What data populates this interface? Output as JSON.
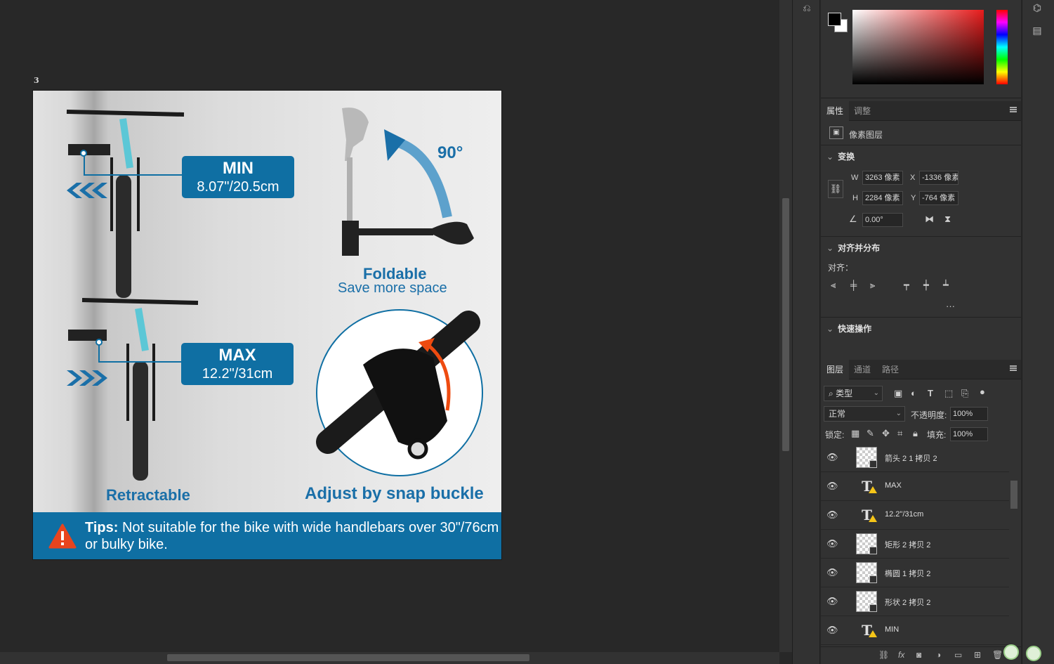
{
  "artboard": {
    "label": "3",
    "callouts": {
      "min_title": "MIN",
      "min_value": "8.07\"/20.5cm",
      "max_title": "MAX",
      "max_value": "12.2\"/31cm"
    },
    "captions": {
      "retractable": "Retractable",
      "snap": "Adjust by snap buckle",
      "foldable": "Foldable",
      "save_space": "Save more space",
      "degrees": "90°"
    },
    "tips": {
      "prefix": "Tips:",
      "text": " Not suitable for the bike with wide handlebars over 30\"/76cm or bulky bike."
    }
  },
  "properties_panel": {
    "tabs": [
      "属性",
      "调整"
    ],
    "layer_type": "像素图层",
    "transform_title": "变换",
    "w_label": "W",
    "w_value": "3263 像素",
    "h_label": "H",
    "h_value": "2284 像素",
    "x_label": "X",
    "x_value": "-1336 像素",
    "y_label": "Y",
    "y_value": "-764 像素",
    "angle_value": "0.00°",
    "align_title": "对齐并分布",
    "align_label": "对齐：",
    "more": "···",
    "quick_actions_title": "快速操作"
  },
  "layers_panel": {
    "tabs": [
      "图层",
      "通道",
      "路径"
    ],
    "filter_kind": "类型",
    "blend_mode": "正常",
    "opacity_label": "不透明度:",
    "opacity_value": "100%",
    "lock_label": "锁定:",
    "fill_label": "填充:",
    "fill_value": "100%",
    "layers": [
      {
        "name": "箭头 2 1 拷贝 2",
        "kind": "shape"
      },
      {
        "name": "MAX",
        "kind": "text"
      },
      {
        "name": "12.2\"/31cm",
        "kind": "text"
      },
      {
        "name": "矩形 2 拷贝 2",
        "kind": "shape"
      },
      {
        "name": "椭圆 1 拷贝 2",
        "kind": "shape"
      },
      {
        "name": "形状 2 拷贝 2",
        "kind": "shape"
      },
      {
        "name": "MIN",
        "kind": "text"
      }
    ]
  },
  "colors": {
    "accent_blue": "#0f6fa3",
    "foreground": "#000000",
    "background": "#ffffff",
    "tips_icon": "#e8441e"
  }
}
